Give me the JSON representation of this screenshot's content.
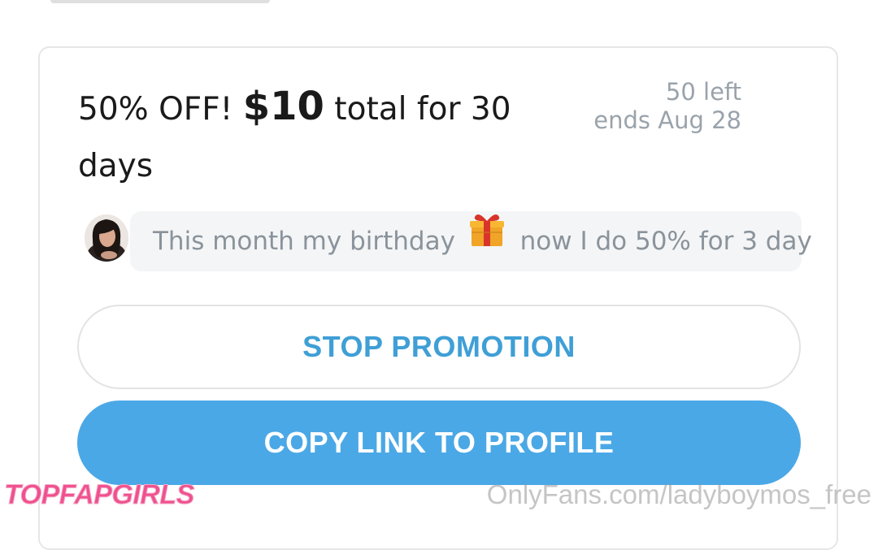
{
  "promotion": {
    "title_prefix": "50% OFF! ",
    "price": "$10",
    "title_suffix": " total for 30 days",
    "remaining": "50 left",
    "ends": "ends Aug 28",
    "message_part1": "This month my birthday",
    "message_part2": "now I do 50% for 3 day",
    "message_emoji": "gift-icon"
  },
  "actions": {
    "stop_label": "STOP PROMOTION",
    "copy_label": "COPY LINK TO PROFILE"
  },
  "watermarks": {
    "left": "TOPFAPGIRLS",
    "right": "OnlyFans.com/ladyboymos_free"
  },
  "colors": {
    "accent": "#4ba8e6",
    "accent_text": "#3f9fd6",
    "muted_text": "#9aa3ab",
    "bubble_bg": "#f4f5f6"
  }
}
